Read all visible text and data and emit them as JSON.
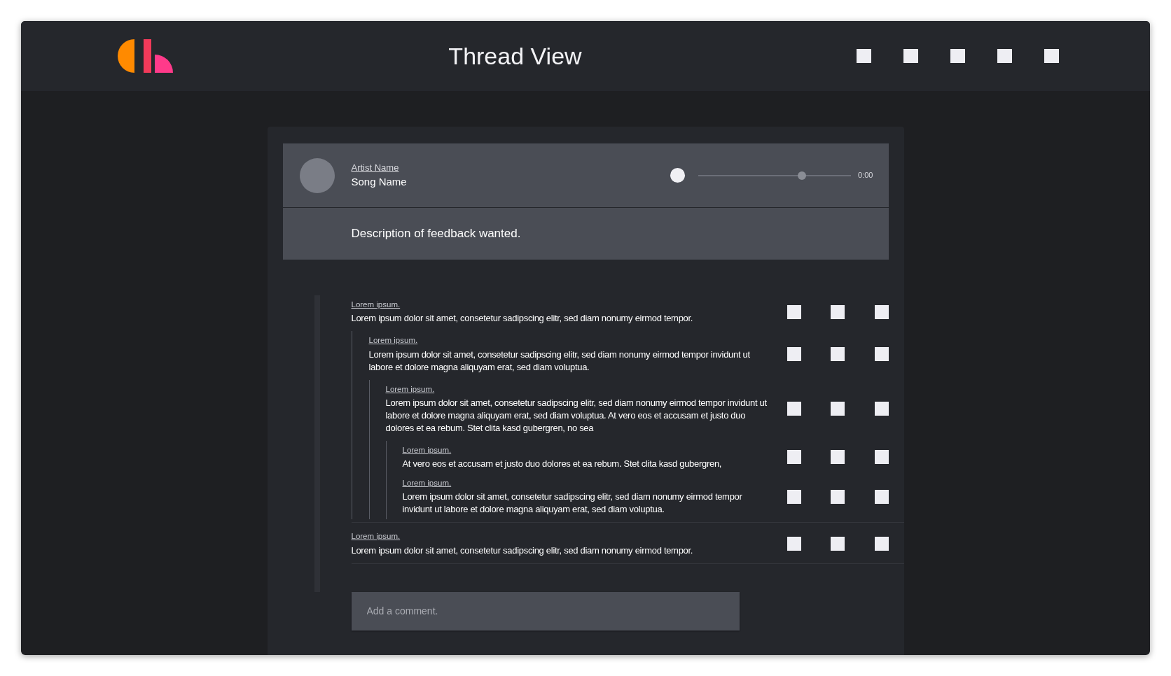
{
  "header": {
    "title": "Thread View"
  },
  "player": {
    "artist": "Artist Name",
    "song": "Song Name",
    "level": 0.69,
    "time": "0:00"
  },
  "description": "Description of feedback wanted.",
  "comments": [
    {
      "author": "Lorem ipsum.",
      "text": "Lorem ipsum dolor sit amet, consetetur sadipscing elitr, sed diam nonumy eirmod tempor.",
      "children": [
        {
          "author": "Lorem ipsum.",
          "text": "Lorem ipsum dolor sit amet, consetetur sadipscing elitr, sed diam nonumy eirmod tempor invidunt ut labore et dolore magna aliquyam erat, sed diam voluptua.",
          "children": [
            {
              "author": "Lorem ipsum.",
              "text": "Lorem ipsum dolor sit amet, consetetur sadipscing elitr, sed diam nonumy eirmod tempor invidunt ut labore et dolore magna aliquyam erat, sed diam voluptua. At vero eos et accusam et justo duo dolores et ea rebum. Stet clita kasd gubergren, no sea",
              "children": [
                {
                  "author": "Lorem ipsum.",
                  "text": "At vero eos et accusam et justo duo dolores et ea rebum. Stet clita kasd gubergren,"
                },
                {
                  "author": "Lorem ipsum.",
                  "text": "Lorem ipsum dolor sit amet, consetetur sadipscing elitr, sed diam nonumy eirmod tempor invidunt ut labore et dolore magna aliquyam erat, sed diam voluptua."
                }
              ]
            }
          ]
        }
      ]
    },
    {
      "author": "Lorem ipsum.",
      "text": "Lorem ipsum dolor sit amet, consetetur sadipscing elitr, sed diam nonumy eirmod tempor."
    }
  ],
  "comment_field": {
    "placeholder": "Add a comment."
  }
}
